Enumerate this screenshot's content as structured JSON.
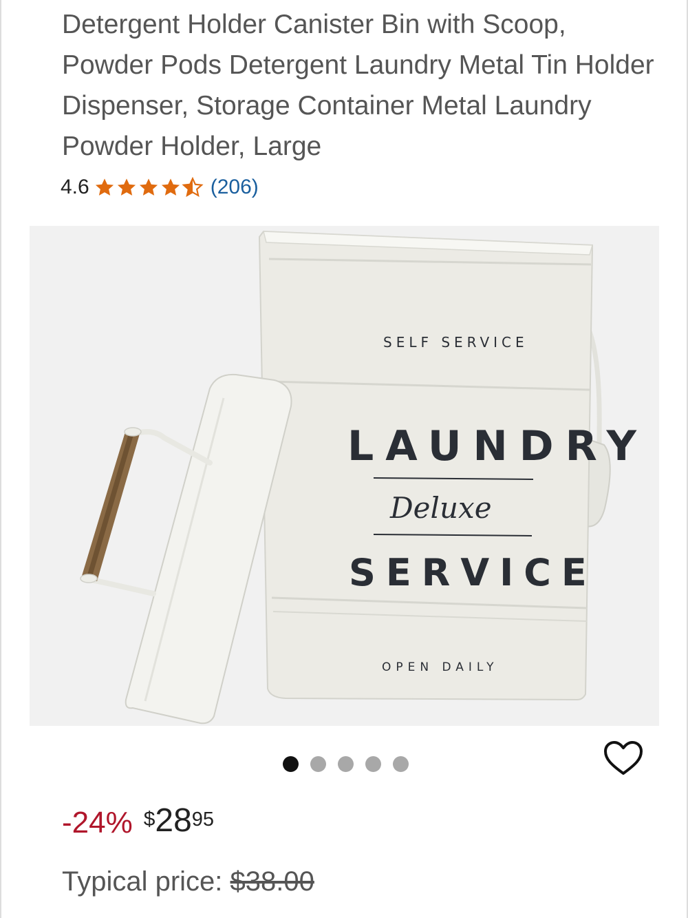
{
  "product": {
    "title": "Detergent Holder Canister Bin with Scoop, Powder Pods Detergent Laundry Metal Tin Holder Dispenser, Storage Container Metal Laundry Powder Holder, Large",
    "rating": {
      "value": "4.6",
      "stars_filled": 4.6,
      "stars_total": 5,
      "review_count": "(206)",
      "star_color": "#e06b0f"
    },
    "image": {
      "alt_icon": "laundry-canister-photo",
      "canister_text": {
        "top": "SELF SERVICE",
        "main": "LAUNDRY",
        "script": "Deluxe",
        "bottom": "SERVICE",
        "footer": "OPEN DAILY"
      }
    },
    "carousel": {
      "total": 5,
      "active_index": 0
    },
    "favorite_icon": "heart-outline-icon",
    "price": {
      "discount": "-24%",
      "currency": "$",
      "dollars": "28",
      "cents": "95",
      "discount_color": "#b0162b"
    },
    "typical_price": {
      "label": "Typical price: ",
      "value": "$38.00"
    }
  }
}
